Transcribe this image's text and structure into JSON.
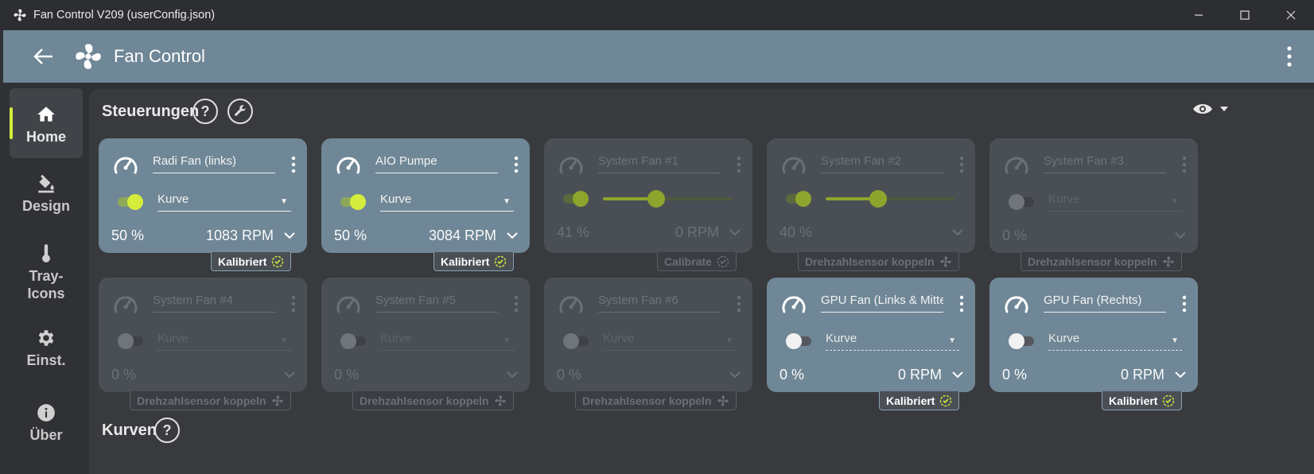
{
  "window": {
    "title": "Fan Control V209 (userConfig.json)"
  },
  "appbar": {
    "title": "Fan Control"
  },
  "sidebar": {
    "items": [
      {
        "label": "Home",
        "icon": "home-icon"
      },
      {
        "label": "Design",
        "icon": "paint-bucket-icon"
      },
      {
        "label": "Tray-\nIcons",
        "label_line1": "Tray-",
        "label_line2": "Icons",
        "icon": "thermometer-icon"
      },
      {
        "label": "Einst.",
        "icon": "gear-icon"
      },
      {
        "label": "Über",
        "icon": "info-icon"
      }
    ]
  },
  "sections": {
    "controls_title": "Steuerungen",
    "curves_title": "Kurven"
  },
  "colors": {
    "accent": "#d4ec3c",
    "card_on": "#6f8796",
    "card_off": "#4a4f56",
    "header": "#6f8796"
  },
  "cards": [
    {
      "name": "Radi Fan (links)",
      "enabled": true,
      "mode": "Kurve",
      "percent": "50 %",
      "rpm": "1083 RPM",
      "badge": "Kalibriert",
      "badge_icon": "check-circle-icon"
    },
    {
      "name": "AIO Pumpe",
      "enabled": true,
      "mode": "Kurve",
      "percent": "50 %",
      "rpm": "3084 RPM",
      "badge": "Kalibriert",
      "badge_icon": "check-circle-icon"
    },
    {
      "name": "System Fan #1",
      "enabled": false,
      "slider": true,
      "slider_value": 0.41,
      "percent": "41 %",
      "rpm": "0 RPM",
      "badge": "Calibrate",
      "badge_icon": "check-circle-icon"
    },
    {
      "name": "System Fan #2",
      "enabled": false,
      "slider": true,
      "slider_value": 0.4,
      "percent": "40 %",
      "rpm": "",
      "badge": "Drehzahlsensor koppeln",
      "badge_icon": "fan-icon"
    },
    {
      "name": "System Fan #3",
      "enabled": false,
      "mode": "Kurve",
      "percent": "0 %",
      "rpm": "",
      "badge": "Drehzahlsensor koppeln",
      "badge_icon": "fan-icon"
    },
    {
      "name": "System Fan #4",
      "enabled": false,
      "mode": "Kurve",
      "percent": "0 %",
      "rpm": "",
      "badge": "Drehzahlsensor koppeln",
      "badge_icon": "fan-icon"
    },
    {
      "name": "System Fan #5",
      "enabled": false,
      "mode": "Kurve",
      "percent": "0 %",
      "rpm": "",
      "badge": "Drehzahlsensor koppeln",
      "badge_icon": "fan-icon"
    },
    {
      "name": "System Fan #6",
      "enabled": false,
      "mode": "Kurve",
      "percent": "0 %",
      "rpm": "",
      "badge": "Drehzahlsensor koppeln",
      "badge_icon": "fan-icon"
    },
    {
      "name": "GPU Fan (Links & Mitte)",
      "enabled": true,
      "toggle_off": true,
      "mode": "Kurve",
      "percent": "0 %",
      "rpm": "0 RPM",
      "badge": "Kalibriert",
      "badge_icon": "check-circle-icon"
    },
    {
      "name": "GPU Fan (Rechts)",
      "enabled": true,
      "toggle_off": true,
      "mode": "Kurve",
      "percent": "0 %",
      "rpm": "0 RPM",
      "badge": "Kalibriert",
      "badge_icon": "check-circle-icon"
    }
  ]
}
